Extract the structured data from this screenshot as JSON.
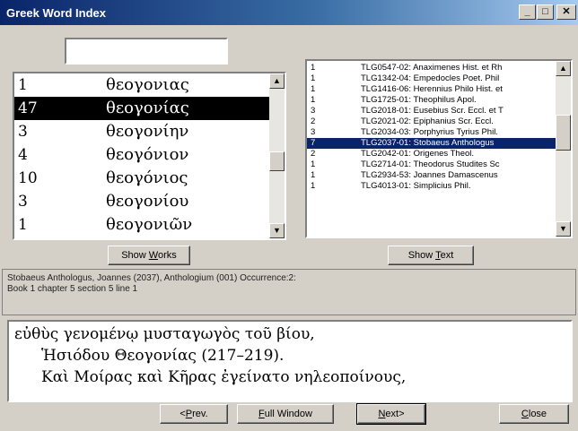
{
  "window": {
    "title": "Greek Word Index",
    "minimize_label": "_",
    "maximize_label": "□",
    "close_label": "✕"
  },
  "search": {
    "value": ""
  },
  "word_list": {
    "rows": [
      {
        "count": "1",
        "word": "θεογονιας"
      },
      {
        "count": "47",
        "word": "θεογονίας",
        "selected": true
      },
      {
        "count": "3",
        "word": "θεογονίην"
      },
      {
        "count": "4",
        "word": "θεογόνιον"
      },
      {
        "count": "10",
        "word": "θεογόνιος"
      },
      {
        "count": "3",
        "word": "θεογονίου"
      },
      {
        "count": "1",
        "word": "θεογονιῶν"
      }
    ],
    "scroll_position": 0.55
  },
  "works_list": {
    "rows": [
      {
        "count": "1",
        "text": "TLG0547-02: Anaximenes Hist. et Rh"
      },
      {
        "count": "1",
        "text": "TLG1342-04: Empedocles Poet. Phil"
      },
      {
        "count": "1",
        "text": "TLG1416-06: Herennius Philo Hist. et"
      },
      {
        "count": "1",
        "text": "TLG1725-01: Theophilus Apol."
      },
      {
        "count": "3",
        "text": "TLG2018-01: Eusebius Scr. Eccl. et T"
      },
      {
        "count": "2",
        "text": "TLG2021-02: Epiphanius Scr. Eccl."
      },
      {
        "count": "3",
        "text": "TLG2034-03: Porphyrius Tyrius Phil."
      },
      {
        "count": "7",
        "text": "TLG2037-01: Stobaeus Anthologus",
        "selected": true
      },
      {
        "count": "2",
        "text": "TLG2042-01: Origenes Theol."
      },
      {
        "count": "1",
        "text": "TLG2714-01: Theodorus Studites Sc"
      },
      {
        "count": "1",
        "text": "TLG2934-53: Joannes Damascenus"
      },
      {
        "count": "1",
        "text": "TLG4013-01: Simplicius Phil."
      }
    ],
    "scroll_position": 0.35
  },
  "buttons": {
    "show_works": {
      "pre": "Show ",
      "u": "W",
      "post": "orks"
    },
    "show_text": {
      "pre": "Show ",
      "u": "T",
      "post": "ext"
    },
    "prev": {
      "pre": "<",
      "u": "P",
      "post": "rev."
    },
    "full_window": {
      "pre": "",
      "u": "F",
      "post": "ull Window"
    },
    "next": {
      "pre": "",
      "u": "N",
      "post": "ext>"
    },
    "close": {
      "pre": "",
      "u": "C",
      "post": "lose"
    }
  },
  "citation": {
    "line1": "Stobaeus Anthologus, Joannes  (2037), Anthologium (001) Occurrence:2:",
    "line2": "Book 1 chapter 5 section 5 line 1"
  },
  "text": {
    "line1": "εὐθὺς γενομένῳ μυσταγωγὸς τοῦ βίου,",
    "line2": "Ἡσιόδου Θεογονίας (217–219).",
    "line3": "Καὶ Μοίρας καὶ Κῆρας ἐγείνατο νηλεοποίνους,"
  },
  "colors": {
    "selection_dark": "#000000",
    "selection_list": "#0a246a",
    "title_start": "#0a246a",
    "title_end": "#a6caf0"
  }
}
